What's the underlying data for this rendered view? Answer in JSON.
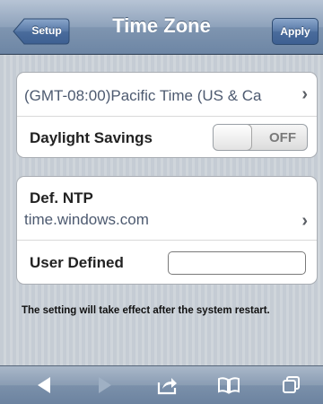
{
  "nav": {
    "title": "Time Zone",
    "back_label": "Setup",
    "apply_label": "Apply"
  },
  "timezone": {
    "value": "(GMT-08:00)Pacific Time (US & Ca",
    "chevron": "›"
  },
  "daylight": {
    "label": "Daylight Savings",
    "state": "OFF"
  },
  "ntp": {
    "label": "Def. NTP",
    "server": "time.windows.com",
    "chevron": "›"
  },
  "user_defined": {
    "label": "User Defined",
    "value": ""
  },
  "note": "The setting will take effect after the system restart.",
  "toolbar": {
    "icons": [
      "back-arrow-icon",
      "forward-arrow-icon",
      "share-icon",
      "bookmarks-icon",
      "tabs-icon"
    ]
  },
  "colors": {
    "navbar": "#7f95b0",
    "background": "#c5ccd4",
    "value_text": "#4d5a70"
  }
}
